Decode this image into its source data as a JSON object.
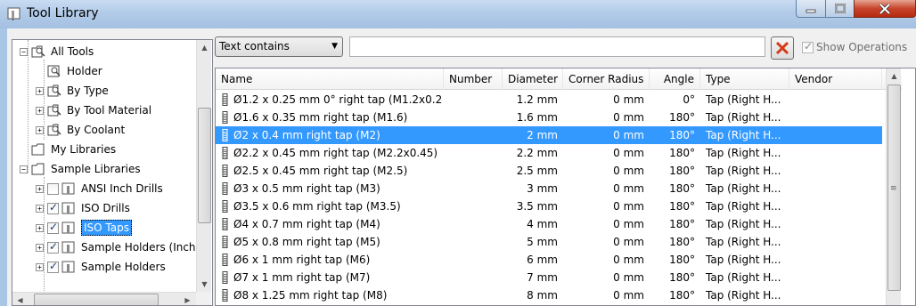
{
  "window": {
    "title": "Tool Library"
  },
  "tree": {
    "items": [
      {
        "label": "All Tools",
        "expander": "−",
        "check": null,
        "selected": false
      },
      {
        "label": "Holder",
        "expander": null,
        "check": null,
        "selected": false
      },
      {
        "label": "By Type",
        "expander": "+",
        "check": null,
        "selected": false
      },
      {
        "label": "By Tool Material",
        "expander": "+",
        "check": null,
        "selected": false
      },
      {
        "label": "By Coolant",
        "expander": "+",
        "check": null,
        "selected": false
      },
      {
        "label": "My Libraries",
        "expander": null,
        "check": null,
        "selected": false
      },
      {
        "label": "Sample Libraries",
        "expander": "−",
        "check": null,
        "selected": false
      },
      {
        "label": "ANSI Inch Drills",
        "expander": "+",
        "check": false,
        "selected": false
      },
      {
        "label": "ISO Drills",
        "expander": "+",
        "check": true,
        "selected": false
      },
      {
        "label": "ISO Taps",
        "expander": "+",
        "check": true,
        "selected": true
      },
      {
        "label": "Sample Holders (Inch)",
        "expander": "+",
        "check": true,
        "selected": false
      },
      {
        "label": "Sample Holders",
        "expander": "+",
        "check": true,
        "selected": false
      }
    ]
  },
  "toolbar": {
    "filter_mode": "Text contains",
    "search_value": "",
    "show_operations_label": "Show Operations",
    "show_operations_checked": true
  },
  "table": {
    "columns": [
      "Name",
      "Number",
      "Diameter",
      "Corner Radius",
      "Angle",
      "Type",
      "Vendor"
    ],
    "rows": [
      {
        "name": "Ø1.2 x 0.25 mm 0° right tap (M1.2x0.25)",
        "number": "",
        "diameter": "1.2 mm",
        "corner_radius": "0 mm",
        "angle": "0°",
        "type": "Tap (Right H...",
        "vendor": "",
        "selected": false
      },
      {
        "name": "Ø1.6 x 0.35 mm right tap (M1.6)",
        "number": "",
        "diameter": "1.6 mm",
        "corner_radius": "0 mm",
        "angle": "180°",
        "type": "Tap (Right H...",
        "vendor": "",
        "selected": false
      },
      {
        "name": "Ø2 x 0.4 mm right tap (M2)",
        "number": "",
        "diameter": "2 mm",
        "corner_radius": "0 mm",
        "angle": "180°",
        "type": "Tap (Right H...",
        "vendor": "",
        "selected": true
      },
      {
        "name": "Ø2.2 x 0.45 mm right tap (M2.2x0.45)",
        "number": "",
        "diameter": "2.2 mm",
        "corner_radius": "0 mm",
        "angle": "180°",
        "type": "Tap (Right H...",
        "vendor": "",
        "selected": false
      },
      {
        "name": "Ø2.5 x 0.45 mm right tap (M2.5)",
        "number": "",
        "diameter": "2.5 mm",
        "corner_radius": "0 mm",
        "angle": "180°",
        "type": "Tap (Right H...",
        "vendor": "",
        "selected": false
      },
      {
        "name": "Ø3 x 0.5 mm right tap (M3)",
        "number": "",
        "diameter": "3 mm",
        "corner_radius": "0 mm",
        "angle": "180°",
        "type": "Tap (Right H...",
        "vendor": "",
        "selected": false
      },
      {
        "name": "Ø3.5 x 0.6 mm right tap (M3.5)",
        "number": "",
        "diameter": "3.5 mm",
        "corner_radius": "0 mm",
        "angle": "180°",
        "type": "Tap (Right H...",
        "vendor": "",
        "selected": false
      },
      {
        "name": "Ø4 x 0.7 mm right tap (M4)",
        "number": "",
        "diameter": "4 mm",
        "corner_radius": "0 mm",
        "angle": "180°",
        "type": "Tap (Right H...",
        "vendor": "",
        "selected": false
      },
      {
        "name": "Ø5 x 0.8 mm right tap (M5)",
        "number": "",
        "diameter": "5 mm",
        "corner_radius": "0 mm",
        "angle": "180°",
        "type": "Tap (Right H...",
        "vendor": "",
        "selected": false
      },
      {
        "name": "Ø6 x 1 mm right tap (M6)",
        "number": "",
        "diameter": "6 mm",
        "corner_radius": "0 mm",
        "angle": "180°",
        "type": "Tap (Right H...",
        "vendor": "",
        "selected": false
      },
      {
        "name": "Ø7 x 1 mm right tap (M7)",
        "number": "",
        "diameter": "7 mm",
        "corner_radius": "0 mm",
        "angle": "180°",
        "type": "Tap (Right H...",
        "vendor": "",
        "selected": false
      },
      {
        "name": "Ø8 x 1.25 mm right tap (M8)",
        "number": "",
        "diameter": "8 mm",
        "corner_radius": "0 mm",
        "angle": "180°",
        "type": "Tap (Right H...",
        "vendor": "",
        "selected": false
      }
    ]
  },
  "colors": {
    "selection": "#3399ff",
    "close_button": "#c7452c",
    "titlebar": "#b2cbe8"
  }
}
